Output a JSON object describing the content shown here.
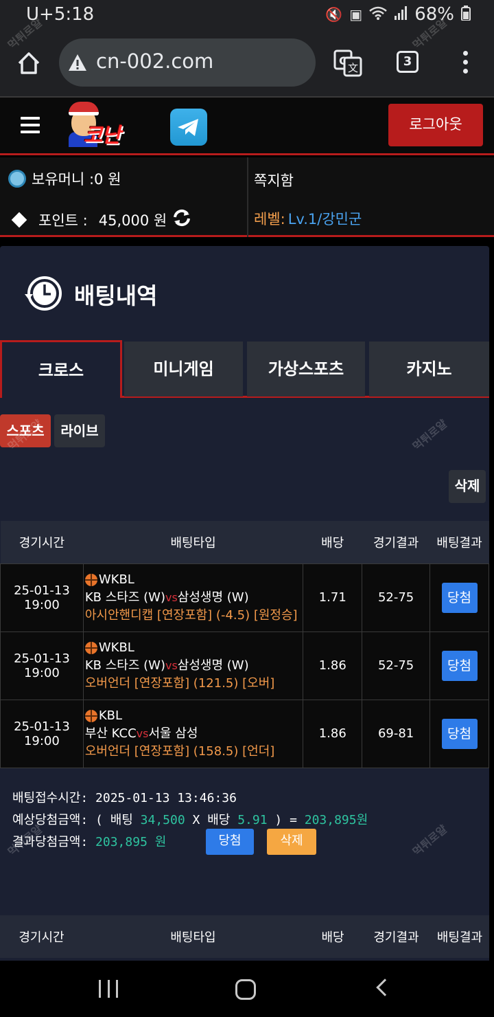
{
  "status_bar": {
    "time": "5:18",
    "carrier": "U+",
    "battery": "68%",
    "icons": [
      "mute-icon",
      "battery-saver-icon",
      "wifi-icon",
      "signal-icon",
      "battery-icon"
    ]
  },
  "browser": {
    "url": "cn-002.com",
    "tab_count": "3",
    "icons": [
      "home-icon",
      "warning-icon",
      "translate-icon",
      "tabs-icon",
      "more-vertical-icon"
    ]
  },
  "header": {
    "logo_text": "코난",
    "logout_label": "로그아웃",
    "icons": [
      "hamburger-icon",
      "telegram-icon"
    ]
  },
  "info": {
    "money_label": "보유머니 :0 원",
    "message_label": "쪽지함",
    "point_label": "포인트 :",
    "point_value": "45,000 원",
    "level_label": "레벨:",
    "level_value": "Lv.1/강민군"
  },
  "page": {
    "title": "배팅내역",
    "tabs": [
      {
        "label": "크로스",
        "active": true
      },
      {
        "label": "미니게임",
        "active": false
      },
      {
        "label": "가상스포츠",
        "active": false
      },
      {
        "label": "카지노",
        "active": false
      }
    ],
    "subtabs": [
      {
        "label": "스포츠",
        "active": true
      },
      {
        "label": "라이브",
        "active": false
      }
    ],
    "delete_label": "삭제"
  },
  "table": {
    "headers": [
      "경기시간",
      "배팅타입",
      "배당",
      "경기결과",
      "배팅결과"
    ],
    "rows": [
      {
        "date": "25-01-13",
        "time": "19:00",
        "league": "WKBL",
        "home": "KB 스타즈 (W)",
        "vs": "vs",
        "away": "삼성생명 (W)",
        "bet": "아시안핸디캡 [연장포함] (-4.5) [원정승]",
        "odds": "1.71",
        "score": "52-75",
        "result": "당첨"
      },
      {
        "date": "25-01-13",
        "time": "19:00",
        "league": "WKBL",
        "home": "KB 스타즈 (W)",
        "vs": "vs",
        "away": "삼성생명 (W)",
        "bet": "오버언더 [연장포함] (121.5) [오버]",
        "odds": "1.86",
        "score": "52-75",
        "result": "당첨"
      },
      {
        "date": "25-01-13",
        "time": "19:00",
        "league": "KBL",
        "home": "부산 KCC",
        "vs": "vs",
        "away": "서울 삼성",
        "bet": "오버언더 [연장포함] (158.5) [언더]",
        "odds": "1.86",
        "score": "69-81",
        "result": "당첨"
      }
    ]
  },
  "summary": {
    "received_label": "배팅접수시간:",
    "received_value": "2025-01-13 13:46:36",
    "expected_label": "예상당첨금액: ( 배팅",
    "bet_amount": "34,500",
    "x_label": "X 배당",
    "total_odds": "5.91",
    "eq_label": ") =",
    "expected_value": "203,895원",
    "result_label": "결과당첨금액:",
    "result_value": "203,895 원",
    "win_label": "당첨",
    "delete_label": "삭제"
  },
  "table2": {
    "headers": [
      "경기시간",
      "배팅타입",
      "배당",
      "경기결과",
      "배팅결과"
    ]
  },
  "watermark": "먹튀로얄",
  "nav": {
    "icons": [
      "recent-apps-icon",
      "home-nav-icon",
      "back-icon"
    ]
  }
}
